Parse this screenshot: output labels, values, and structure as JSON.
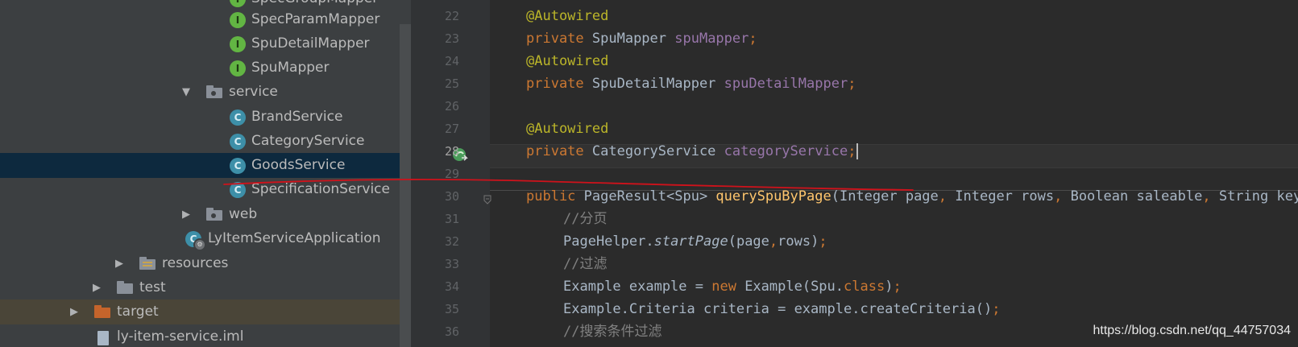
{
  "project_tree": {
    "items": [
      {
        "label": "SpecGroupMapper",
        "kind": "interface",
        "indent": 2
      },
      {
        "label": "SpecParamMapper",
        "kind": "interface",
        "indent": 2
      },
      {
        "label": "SpuDetailMapper",
        "kind": "interface",
        "indent": 2
      },
      {
        "label": "SpuMapper",
        "kind": "interface",
        "indent": 2
      },
      {
        "label": "service",
        "kind": "package",
        "expanded": true
      },
      {
        "label": "BrandService",
        "kind": "class"
      },
      {
        "label": "CategoryService",
        "kind": "class"
      },
      {
        "label": "GoodsService",
        "kind": "class",
        "selected": true
      },
      {
        "label": "SpecificationService",
        "kind": "class"
      },
      {
        "label": "web",
        "kind": "package",
        "expanded": false
      },
      {
        "label": "LyItemServiceApplication",
        "kind": "spring-boot-app"
      },
      {
        "label": "resources",
        "kind": "resources-folder",
        "expanded": false
      },
      {
        "label": "test",
        "kind": "folder",
        "expanded": false
      },
      {
        "label": "target",
        "kind": "excluded-folder",
        "expanded": false
      },
      {
        "label": "ly-item-service.iml",
        "kind": "iml-file"
      }
    ]
  },
  "editor": {
    "current_line": "28",
    "lines": [
      {
        "num": "22",
        "tokens": [
          {
            "t": "@Autowired",
            "c": "ann"
          }
        ]
      },
      {
        "num": "23",
        "tokens": [
          {
            "t": "private ",
            "c": "kw"
          },
          {
            "t": "SpuMapper ",
            "c": ""
          },
          {
            "t": "spuMapper",
            "c": "fld"
          },
          {
            "t": ";",
            "c": "kw"
          }
        ]
      },
      {
        "num": "24",
        "tokens": [
          {
            "t": "@Autowired",
            "c": "ann"
          }
        ]
      },
      {
        "num": "25",
        "tokens": [
          {
            "t": "private ",
            "c": "kw"
          },
          {
            "t": "SpuDetailMapper ",
            "c": ""
          },
          {
            "t": "spuDetailMapper",
            "c": "fld"
          },
          {
            "t": ";",
            "c": "kw"
          }
        ]
      },
      {
        "num": "26",
        "tokens": []
      },
      {
        "num": "27",
        "tokens": [
          {
            "t": "@Autowired",
            "c": "ann"
          }
        ]
      },
      {
        "num": "28",
        "tokens": [
          {
            "t": "private ",
            "c": "kw"
          },
          {
            "t": "CategoryService ",
            "c": ""
          },
          {
            "t": "categoryService",
            "c": "fld"
          },
          {
            "t": ";",
            "c": "kw"
          }
        ]
      },
      {
        "num": "29",
        "tokens": []
      },
      {
        "num": "30",
        "tokens": [
          {
            "t": "public ",
            "c": "kw"
          },
          {
            "t": "PageResult<Spu> ",
            "c": ""
          },
          {
            "t": "querySpuByPage",
            "c": "mth"
          },
          {
            "t": "(Integer page",
            "c": ""
          },
          {
            "t": ", ",
            "c": "kw"
          },
          {
            "t": "Integer rows",
            "c": ""
          },
          {
            "t": ", ",
            "c": "kw"
          },
          {
            "t": "Boolean saleable",
            "c": ""
          },
          {
            "t": ", ",
            "c": "kw"
          },
          {
            "t": "String key",
            "c": ""
          }
        ]
      },
      {
        "num": "31",
        "tokens": [
          {
            "t": "//分页",
            "c": "cmt"
          }
        ]
      },
      {
        "num": "32",
        "tokens": [
          {
            "t": "PageHelper.",
            "c": ""
          },
          {
            "t": "startPage",
            "c": "ital"
          },
          {
            "t": "(page",
            "c": ""
          },
          {
            "t": ",",
            "c": "kw"
          },
          {
            "t": "rows)",
            "c": ""
          },
          {
            "t": ";",
            "c": "kw"
          }
        ]
      },
      {
        "num": "33",
        "tokens": [
          {
            "t": "//过滤",
            "c": "cmt"
          }
        ]
      },
      {
        "num": "34",
        "tokens": [
          {
            "t": "Example example = ",
            "c": ""
          },
          {
            "t": "new ",
            "c": "kw"
          },
          {
            "t": "Example(Spu.",
            "c": ""
          },
          {
            "t": "class",
            "c": "kw"
          },
          {
            "t": ")",
            "c": ""
          },
          {
            "t": ";",
            "c": "kw"
          }
        ]
      },
      {
        "num": "35",
        "tokens": [
          {
            "t": "Example.Criteria criteria = example.createCriteria()",
            "c": ""
          },
          {
            "t": ";",
            "c": "kw"
          }
        ]
      },
      {
        "num": "36",
        "tokens": [
          {
            "t": "//搜索条件过滤",
            "c": "cmt"
          }
        ]
      }
    ]
  },
  "watermark": "https://blog.csdn.net/qq_44757034",
  "colors": {
    "tree_bg": "#3c3f41",
    "selection": "#0d293e",
    "editor_bg": "#2b2b2b",
    "keyword": "#cc7832",
    "annotation": "#bbb529",
    "field": "#9876aa",
    "method": "#ffc66d",
    "comment": "#808080",
    "annotation_stroke": "#d0121b"
  }
}
